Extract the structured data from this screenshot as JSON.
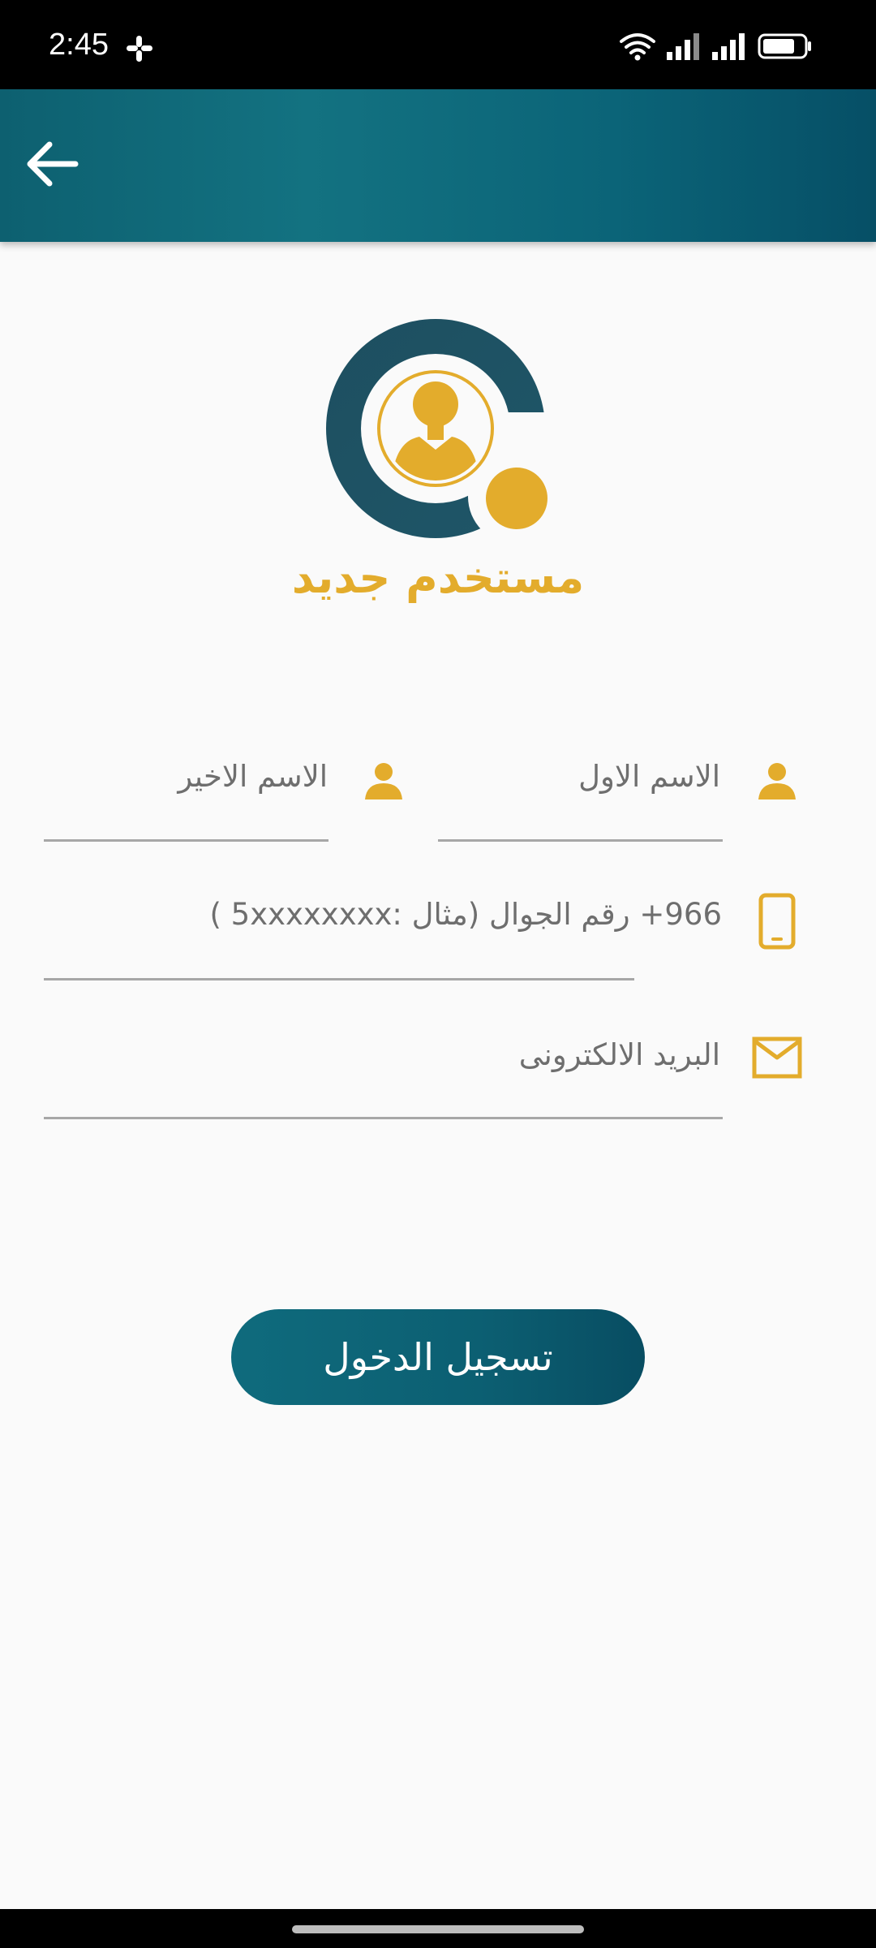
{
  "status_bar": {
    "time": "2:45",
    "icons": [
      "slack-icon",
      "wifi-icon",
      "signal-icon",
      "signal-icon",
      "battery-icon"
    ]
  },
  "app_bar": {
    "back_icon": "arrow-left-icon",
    "background_color": "#0d6a7a"
  },
  "header": {
    "logo_icon": "new-user-logo-icon",
    "title": "مستخدم جديد",
    "accent_color": "#e3ac2c"
  },
  "form": {
    "first_name": {
      "placeholder": "الاسم الاول",
      "icon": "person-icon"
    },
    "last_name": {
      "placeholder": "الاسم الاخير",
      "icon": "person-icon"
    },
    "phone": {
      "placeholder": "966+ رقم الجوال (مثال :5xxxxxxxx )",
      "icon": "phone-icon"
    },
    "email": {
      "placeholder": "البريد الالكترونى",
      "icon": "mail-icon"
    }
  },
  "actions": {
    "login_label": "تسجيل الدخول"
  }
}
